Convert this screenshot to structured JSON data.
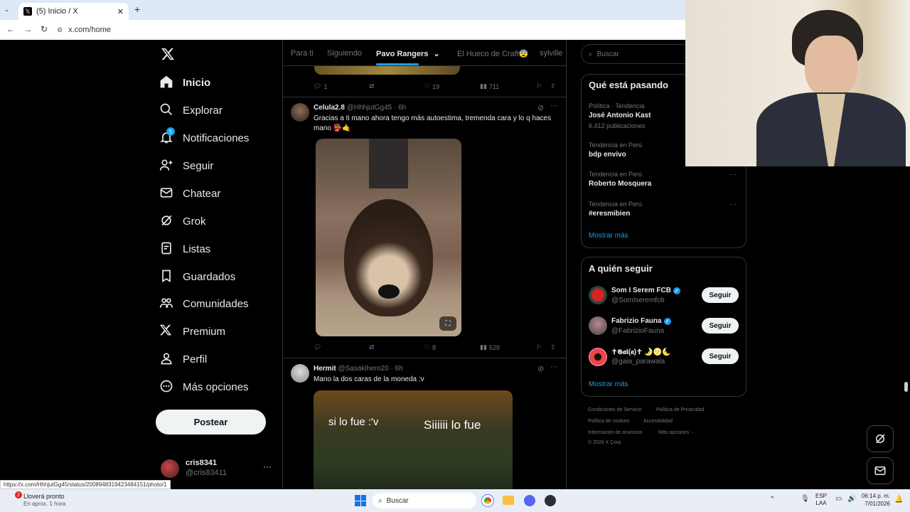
{
  "browser": {
    "tab_title": "(5) Inicio / X",
    "url": "x.com/home",
    "status_url": "https://x.com/HhhjutGg45/status/2008948319423484151/photo/1"
  },
  "nav": {
    "items": [
      {
        "label": "Inicio",
        "icon": "home-icon"
      },
      {
        "label": "Explorar",
        "icon": "search-icon"
      },
      {
        "label": "Notificaciones",
        "icon": "bell-icon",
        "badge": "5"
      },
      {
        "label": "Seguir",
        "icon": "person-add-icon"
      },
      {
        "label": "Chatear",
        "icon": "mail-icon"
      },
      {
        "label": "Grok",
        "icon": "grok-icon"
      },
      {
        "label": "Listas",
        "icon": "list-icon"
      },
      {
        "label": "Guardados",
        "icon": "bookmark-icon"
      },
      {
        "label": "Comunidades",
        "icon": "communities-icon"
      },
      {
        "label": "Premium",
        "icon": "x-logo-icon"
      },
      {
        "label": "Perfil",
        "icon": "person-icon"
      },
      {
        "label": "Más opciones",
        "icon": "more-circle-icon"
      }
    ],
    "post_button": "Postear",
    "account": {
      "name": "cris8341",
      "handle": "@cris83411"
    }
  },
  "timeline": {
    "tabs": [
      "Para ti",
      "Siguiendo",
      "Pavo Rangers",
      "El Hueco de Craft😨",
      "sylville"
    ],
    "active_tab": "Pavo Rangers",
    "prev_tweet_actions": {
      "replies": "1",
      "retweets": "",
      "likes": "19",
      "views": "711"
    },
    "tweets": [
      {
        "name": "Celula2.8",
        "handle": "@HhhjutGg45",
        "time": "· 6h",
        "text": "Gracias a ti mano ahora tengo más autoestima, tremenda cara y lo q haces mano 👺🤙",
        "replies": "",
        "retweets": "",
        "likes": "8",
        "views": "529"
      },
      {
        "name": "Hermit",
        "handle": "@Sasakihero20",
        "time": "· 6h",
        "text": "Mano la dos caras de la moneda :v",
        "image_text_left": "si lo fue :'v",
        "image_text_right": "Siiiiii lo fue"
      }
    ]
  },
  "right": {
    "search_placeholder": "Buscar",
    "trends_title": "Qué está pasando",
    "trends": [
      {
        "category": "Política · Tendencia",
        "name": "José Antonio Kast",
        "count": "6.412 publicaciones"
      },
      {
        "category": "Tendencia en Perú",
        "name": "bdp envivo",
        "count": ""
      },
      {
        "category": "Tendencia en Perú",
        "name": "Roberto Mosquera",
        "count": ""
      },
      {
        "category": "Tendencia en Perú",
        "name": "#eresmibien",
        "count": ""
      }
    ],
    "show_more": "Mostrar más",
    "who_to_follow_title": "A quién seguir",
    "follow": [
      {
        "name": "Som I Serem FCB",
        "handle": "@SomIseremfcb",
        "verified": true,
        "button": "Seguir"
      },
      {
        "name": "Fabrizio Fauna",
        "handle": "@FabrizioFauna",
        "verified": true,
        "button": "Seguir"
      },
      {
        "name": "✝𝕲𝖆𝖎(𝖆)✝ 🌛🌝🌜",
        "handle": "@gaia_parawala",
        "verified": false,
        "button": "Seguir"
      }
    ],
    "show_more_2": "Mostrar más",
    "footer": [
      "Condiciones de Servicio",
      "Política de Privacidad",
      "Política de cookies",
      "Accesibilidad",
      "Información de anuncios",
      "Más opciones ···",
      "© 2026 X Corp."
    ]
  },
  "taskbar": {
    "weather_title": "Lloverá pronto",
    "weather_sub": "En aprox. 1 hora",
    "weather_badge": "2",
    "search": "Buscar",
    "lang1": "ESP",
    "lang2": "LAA",
    "time": "06:14 p. m.",
    "date": "7/01/2026"
  }
}
